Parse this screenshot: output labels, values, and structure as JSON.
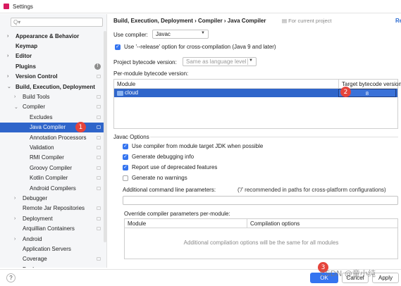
{
  "window": {
    "title": "Settings"
  },
  "sidebar": {
    "search_placeholder": "Q▾",
    "items": [
      {
        "label": "Appearance & Behavior",
        "chev": "›",
        "indent": 0,
        "bold": true
      },
      {
        "label": "Keymap",
        "chev": "",
        "indent": 0,
        "bold": true
      },
      {
        "label": "Editor",
        "chev": "›",
        "indent": 0,
        "bold": true
      },
      {
        "label": "Plugins",
        "chev": "",
        "indent": 0,
        "bold": true,
        "info": "!"
      },
      {
        "label": "Version Control",
        "chev": "›",
        "indent": 0,
        "bold": true,
        "page": true
      },
      {
        "label": "Build, Execution, Deployment",
        "chev": "⌄",
        "indent": 0,
        "bold": true
      },
      {
        "label": "Build Tools",
        "chev": "›",
        "indent": 1,
        "page": true
      },
      {
        "label": "Compiler",
        "chev": "⌄",
        "indent": 1,
        "page": true
      },
      {
        "label": "Excludes",
        "chev": "",
        "indent": 2,
        "page": true
      },
      {
        "label": "Java Compiler",
        "chev": "",
        "indent": 2,
        "page": true,
        "selected": true
      },
      {
        "label": "Annotation Processors",
        "chev": "",
        "indent": 2,
        "page": true
      },
      {
        "label": "Validation",
        "chev": "",
        "indent": 2,
        "page": true
      },
      {
        "label": "RMI Compiler",
        "chev": "",
        "indent": 2,
        "page": true
      },
      {
        "label": "Groovy Compiler",
        "chev": "",
        "indent": 2,
        "page": true
      },
      {
        "label": "Kotlin Compiler",
        "chev": "",
        "indent": 2,
        "page": true
      },
      {
        "label": "Android Compilers",
        "chev": "",
        "indent": 2,
        "page": true
      },
      {
        "label": "Debugger",
        "chev": "›",
        "indent": 1
      },
      {
        "label": "Remote Jar Repositories",
        "chev": "",
        "indent": 1,
        "page": true
      },
      {
        "label": "Deployment",
        "chev": "›",
        "indent": 1,
        "page": true
      },
      {
        "label": "Arquillian Containers",
        "chev": "",
        "indent": 1,
        "page": true
      },
      {
        "label": "Android",
        "chev": "›",
        "indent": 1
      },
      {
        "label": "Application Servers",
        "chev": "",
        "indent": 1
      },
      {
        "label": "Coverage",
        "chev": "",
        "indent": 1,
        "page": true
      },
      {
        "label": "Docker",
        "chev": "›",
        "indent": 1
      }
    ]
  },
  "header": {
    "breadcrumb": "Build, Execution, Deployment  ›  Compiler  ›  Java Compiler",
    "scope_note": "For current project",
    "reset_label": "Re"
  },
  "compiler": {
    "use_compiler_label": "Use compiler:",
    "use_compiler_value": "Javac",
    "release_option_label": "Use '--release' option for cross-compilation (Java 9 and later)",
    "project_bytecode_label": "Project bytecode version:",
    "project_bytecode_value": "Same as language level",
    "per_module_label": "Per-module bytecode version:"
  },
  "bytecode_table": {
    "col_module": "Module",
    "col_target": "Target bytecode version",
    "rows": [
      {
        "module": "cloud",
        "target": "8"
      }
    ]
  },
  "javac": {
    "section_title": "Javac Options",
    "options": [
      {
        "label": "Use compiler from module target JDK when possible",
        "checked": true
      },
      {
        "label": "Generate debugging info",
        "checked": true
      },
      {
        "label": "Report use of deprecated features",
        "checked": true
      },
      {
        "label": "Generate no warnings",
        "checked": false
      }
    ],
    "additional_params_label": "Additional command line parameters:",
    "additional_params_hint": "('/' recommended in paths for cross-platform configurations)",
    "additional_params_value": "",
    "override_label": "Override compiler parameters per-module:"
  },
  "override_table": {
    "col_module": "Module",
    "col_options": "Compilation options",
    "empty_text": "Additional compilation options will be the same for all modules"
  },
  "footer": {
    "help": "?",
    "ok_label": "OK",
    "cancel_label": "Cancel",
    "apply_label": "Apply"
  },
  "annotations": {
    "badge1": "1",
    "badge2": "2",
    "badge3": "3"
  },
  "watermark": "CSDN @童小纯",
  "colors": {
    "accent": "#3574f0",
    "selection": "#2f65ca",
    "badge": "#e5443b"
  }
}
